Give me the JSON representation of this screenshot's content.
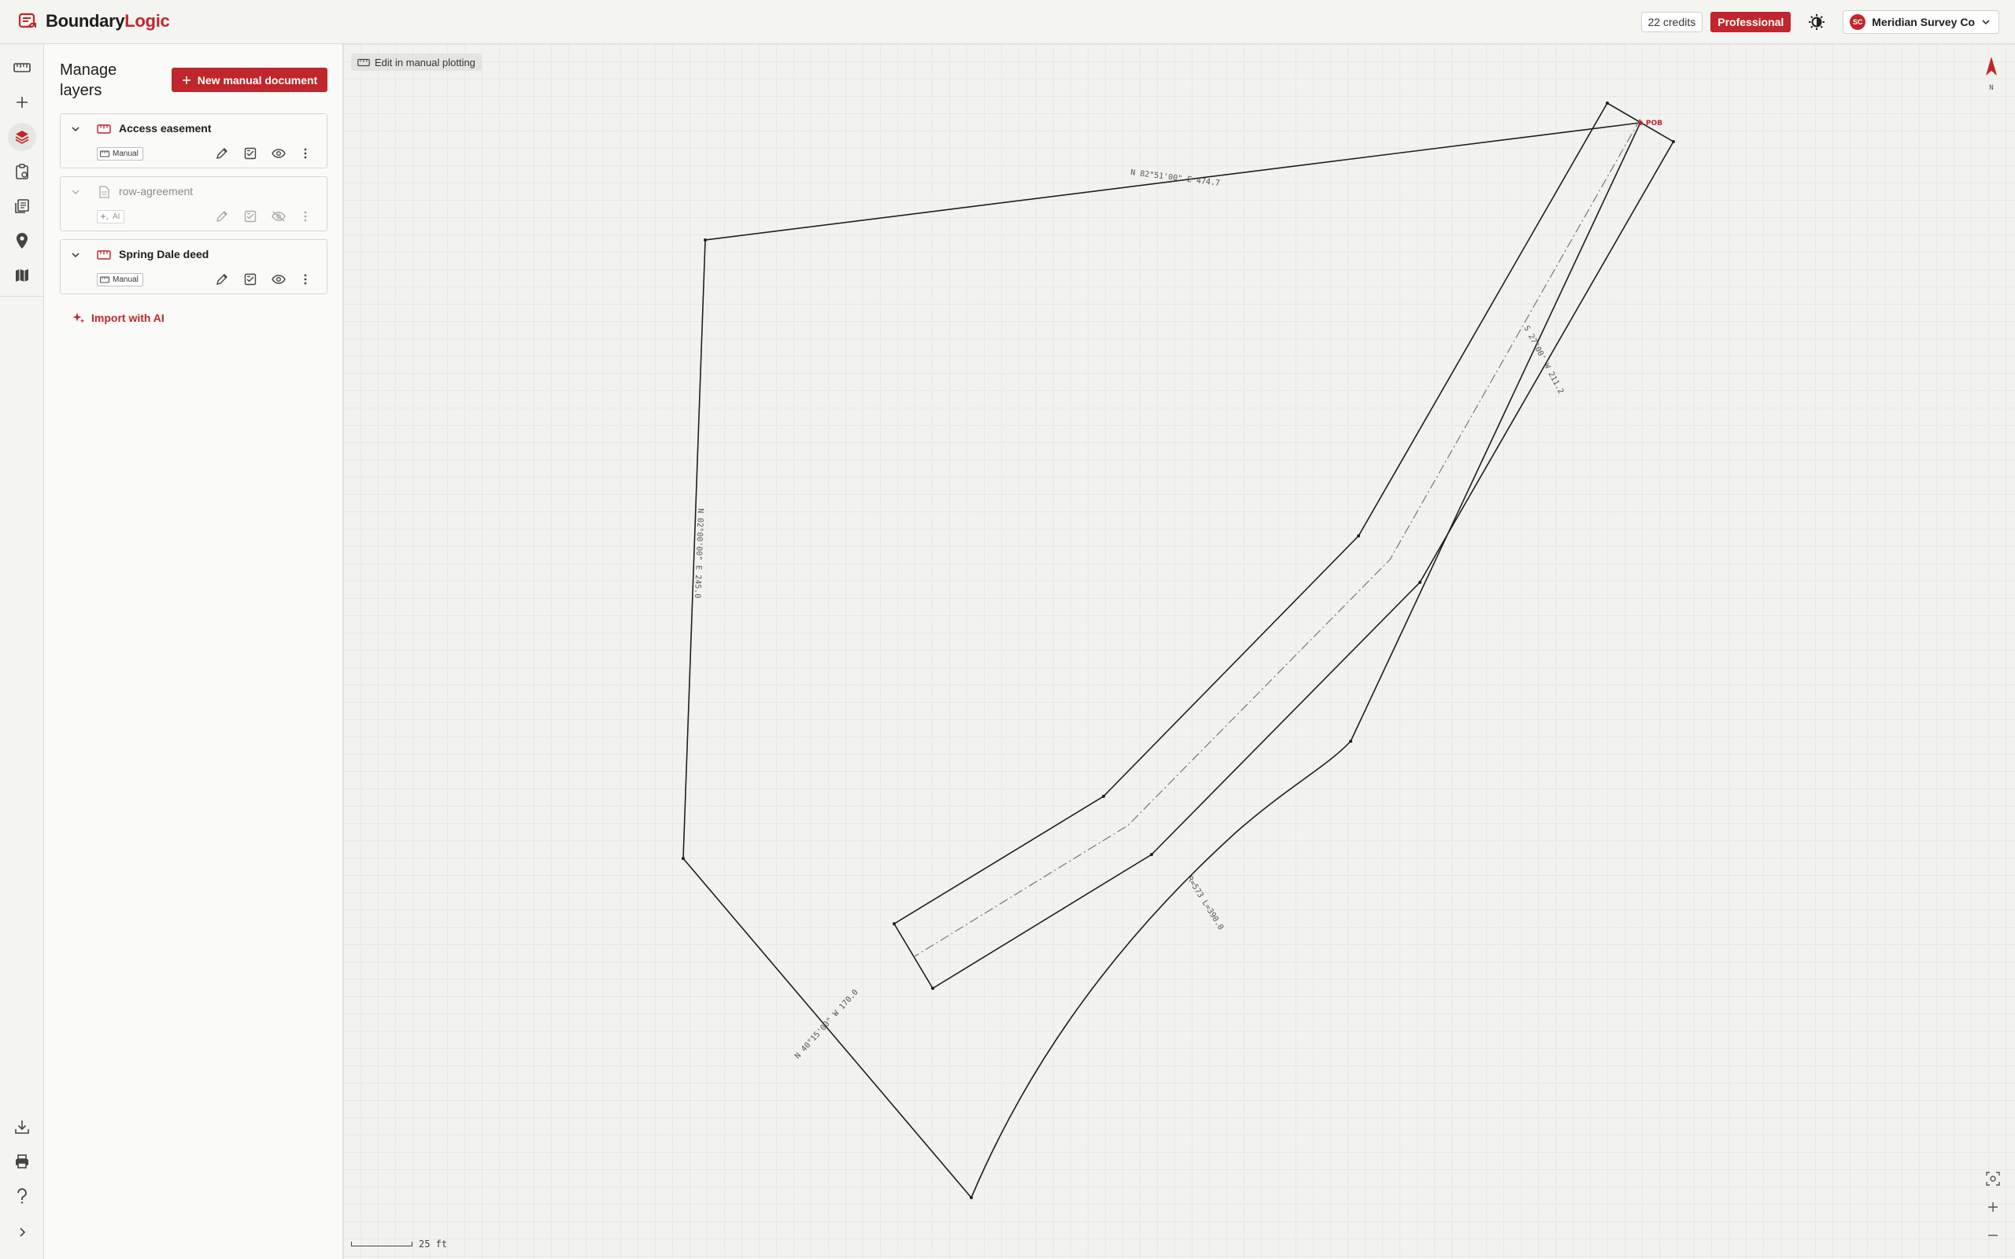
{
  "app": {
    "name_part1": "Boundary",
    "name_part2": "Logic"
  },
  "header": {
    "credits": "22 credits",
    "plan": "Professional",
    "org_initials": "SC",
    "org_name": "Meridian Survey Co"
  },
  "rail": {
    "items": [
      "ruler-icon",
      "plus-icon",
      "layers-icon",
      "clipboard-icon",
      "documents-icon",
      "pin-icon",
      "map-icon"
    ],
    "bottom": [
      "download-icon",
      "print-icon",
      "help-icon",
      "expand-icon"
    ]
  },
  "panel": {
    "title": "Manage layers",
    "new_button": "New manual document",
    "layers": [
      {
        "name": "Access easement",
        "badge": "Manual",
        "visible": true
      },
      {
        "name": "row-agreement",
        "badge": "AI",
        "visible": false
      },
      {
        "name": "Spring Dale deed",
        "badge": "Manual",
        "visible": true
      }
    ],
    "import_ai": "Import with AI"
  },
  "map": {
    "edit_chip": "Edit in manual plotting",
    "north_label": "N",
    "scale_label": "25 ft",
    "pob_label": "POB",
    "annotations": {
      "north_call": "N 82°51'00\" E 474.7",
      "west_call": "N 02°00'00\" E 245.0",
      "sw_call": "N 40°15'00\" W 170.0",
      "curve_call": "R=573 L=390.0",
      "easement_call": "S 27°00' W 211.2"
    }
  }
}
